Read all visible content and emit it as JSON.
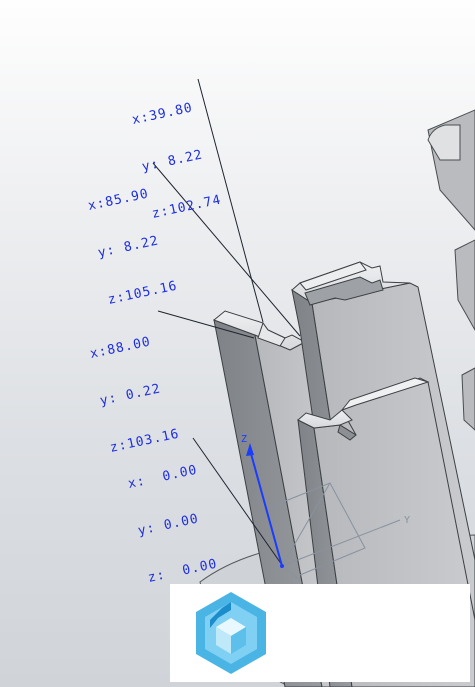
{
  "viewport": {
    "name": "3D model viewport"
  },
  "coordinate_labels": [
    {
      "id": "p1",
      "x": "x:39.80",
      "y": "y: 8.22",
      "z": "z:102.74"
    },
    {
      "id": "p2",
      "x": "x:85.90",
      "y": "y: 8.22",
      "z": "z:105.16"
    },
    {
      "id": "p3",
      "x": "x:88.00",
      "y": "y: 0.22",
      "z": "z:103.16"
    },
    {
      "id": "p4",
      "x": "x:  0.00",
      "y": "y: 0.00",
      "z": "z:  0.00"
    }
  ],
  "axes": {
    "z_label": "Z",
    "y_label": "Y"
  },
  "colors": {
    "annotation": "#1d2ee0",
    "part_light": "#c3c5c8",
    "part_dark": "#8a8d91",
    "axis": "#1a3cff"
  },
  "overlay": {
    "logo_icon": "cube-hexagon-logo-icon"
  }
}
